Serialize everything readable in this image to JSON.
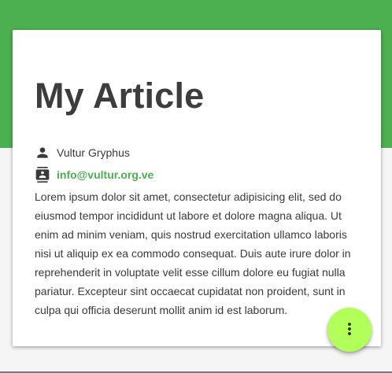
{
  "article": {
    "title": "My Article",
    "author": {
      "name": "Vultur Gryphus",
      "icon": "person-icon"
    },
    "contact": {
      "email": "info@vultur.org.ve",
      "icon": "contact-card-icon"
    },
    "body": "Lorem ipsum dolor sit amet, consectetur adipisicing elit, sed do eiusmod tempor incididunt ut labore et dolore magna aliqua. Ut enim ad minim veniam, quis nostrud exercitation ullamco laboris nisi ut aliquip ex ea commodo consequat. Duis aute irure dolor in reprehenderit in voluptate velit esse cillum dolore eu fugiat nulla pariatur. Excepteur sint occaecat cupidatat non proident, sunt in culpa qui officia deserunt mollit anim id est laborum."
  },
  "fab": {
    "icon": "more-vert-icon"
  },
  "colors": {
    "primary": "#4caf50",
    "accent": "#b2ff59",
    "text": "#3a3a3a",
    "title": "#3d3d3d"
  }
}
